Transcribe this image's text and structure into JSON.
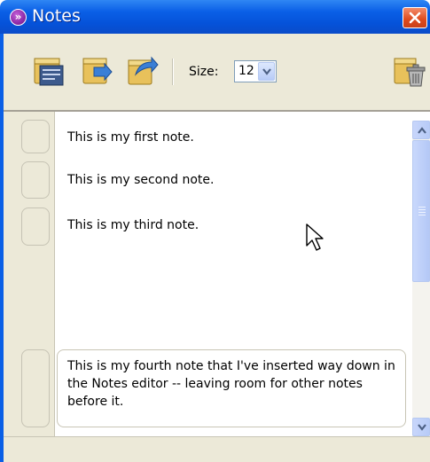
{
  "window": {
    "title": "Notes",
    "app_icon": "»",
    "close_icon": "close-x-icon"
  },
  "toolbar": {
    "buttons": [
      {
        "name": "new-note-icon"
      },
      {
        "name": "import-note-icon"
      },
      {
        "name": "export-note-icon"
      },
      {
        "name": "delete-note-icon"
      }
    ],
    "size_label": "Size:",
    "size_value": "12"
  },
  "notes": [
    {
      "text": "This is my first note."
    },
    {
      "text": "This is my second note."
    },
    {
      "text": "This is my third note."
    },
    {
      "text": "This is my fourth note that I've inserted way down in the Notes editor -- leaving room for other notes before it."
    }
  ],
  "colors": {
    "titlebar": "#0a5fe6",
    "toolbar": "#ece9d8",
    "close_button": "#de4a1d",
    "scrollbar": "#b7cbf7"
  }
}
